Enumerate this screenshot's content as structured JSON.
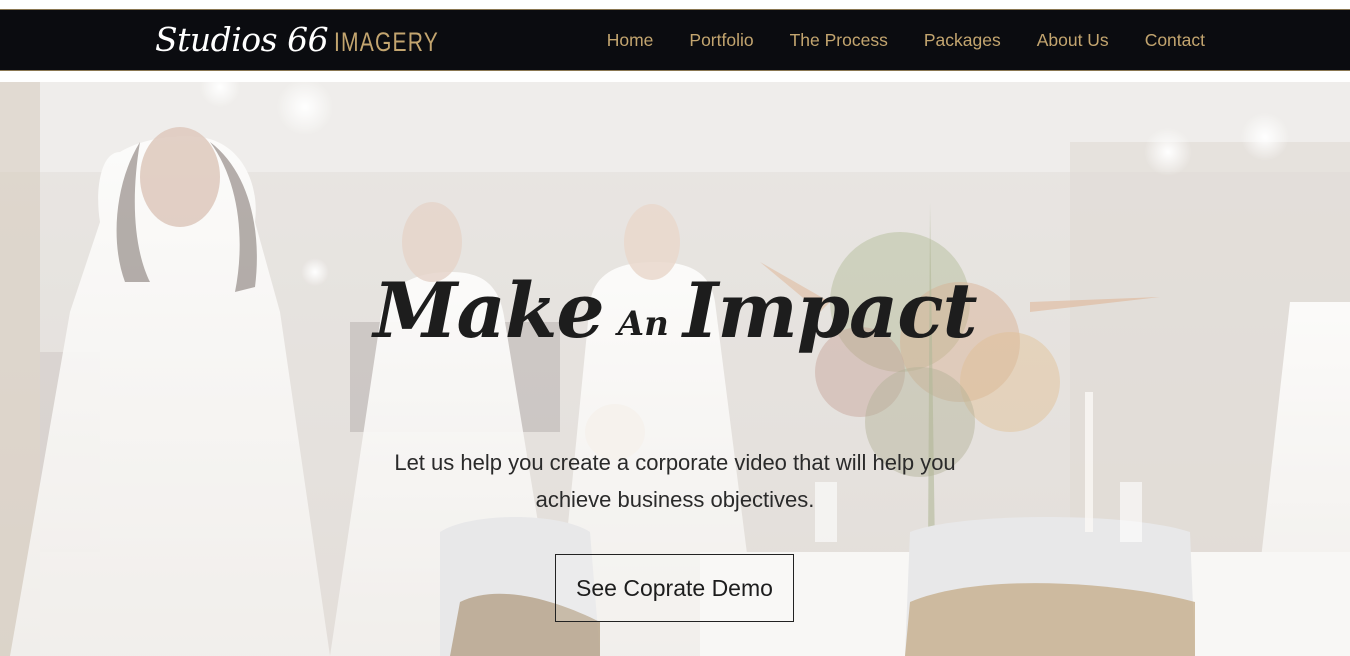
{
  "brand": {
    "script_part": "Studios 66",
    "caps_part": "IMAGERY",
    "accent_color": "#c3a56f",
    "header_bg": "#0b0c10"
  },
  "nav": {
    "items": [
      {
        "label": "Home"
      },
      {
        "label": "Portfolio"
      },
      {
        "label": "The Process"
      },
      {
        "label": "Packages"
      },
      {
        "label": "About Us"
      },
      {
        "label": "Contact"
      }
    ]
  },
  "hero": {
    "title_word_1": "Make",
    "title_connector": "An",
    "title_word_2": "Impact",
    "subtitle": "Let us help you create a corporate video that will help you achieve business objectives.",
    "button_label": "See Coprate Demo",
    "background_image": "wedding-gowns-photo"
  }
}
